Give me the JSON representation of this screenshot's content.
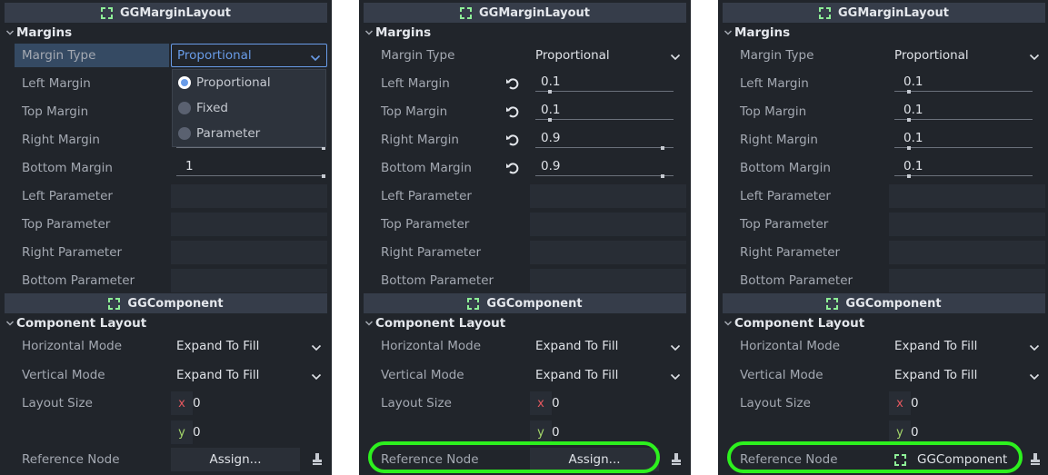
{
  "panels": [
    {
      "margin_header": "GGMarginLayout",
      "margins_section": "Margins",
      "margin_type_label": "Margin Type",
      "margin_type_value": "Proportional",
      "margin_type_open": true,
      "dropdown_options": [
        "Proportional",
        "Fixed",
        "Parameter"
      ],
      "dropdown_selected": 0,
      "left_margin_label": "Left Margin",
      "top_margin_label": "Top Margin",
      "right_margin_label": "Right Margin",
      "bottom_margin_label": "Bottom Margin",
      "bottom_margin_value": "1",
      "left_param_label": "Left Parameter",
      "top_param_label": "Top Parameter",
      "right_param_label": "Right Parameter",
      "bottom_param_label": "Bottom Parameter",
      "component_header": "GGComponent",
      "layout_section": "Component Layout",
      "hmode_label": "Horizontal Mode",
      "hmode_value": "Expand To Fill",
      "vmode_label": "Vertical Mode",
      "vmode_value": "Expand To Fill",
      "size_label": "Layout Size",
      "size_x_axis": "x",
      "size_x": "0",
      "size_y_axis": "y",
      "size_y": "0",
      "ref_label": "Reference Node",
      "ref_value": "Assign..."
    },
    {
      "margin_header": "GGMarginLayout",
      "margins_section": "Margins",
      "margin_type_label": "Margin Type",
      "margin_type_value": "Proportional",
      "left_margin_label": "Left Margin",
      "left_margin_value": "0.1",
      "top_margin_label": "Top Margin",
      "top_margin_value": "0.1",
      "right_margin_label": "Right Margin",
      "right_margin_value": "0.9",
      "bottom_margin_label": "Bottom Margin",
      "bottom_margin_value": "0.9",
      "left_param_label": "Left Parameter",
      "top_param_label": "Top Parameter",
      "right_param_label": "Right Parameter",
      "bottom_param_label": "Bottom Parameter",
      "component_header": "GGComponent",
      "layout_section": "Component Layout",
      "hmode_label": "Horizontal Mode",
      "hmode_value": "Expand To Fill",
      "vmode_label": "Vertical Mode",
      "vmode_value": "Expand To Fill",
      "size_label": "Layout Size",
      "size_x_axis": "x",
      "size_x": "0",
      "size_y_axis": "y",
      "size_y": "0",
      "ref_label": "Reference Node",
      "ref_value": "Assign..."
    },
    {
      "margin_header": "GGMarginLayout",
      "margins_section": "Margins",
      "margin_type_label": "Margin Type",
      "margin_type_value": "Proportional",
      "left_margin_label": "Left Margin",
      "left_margin_value": "0.1",
      "top_margin_label": "Top Margin",
      "top_margin_value": "0.1",
      "right_margin_label": "Right Margin",
      "right_margin_value": "0.1",
      "bottom_margin_label": "Bottom Margin",
      "bottom_margin_value": "0.1",
      "left_param_label": "Left Parameter",
      "top_param_label": "Top Parameter",
      "right_param_label": "Right Parameter",
      "bottom_param_label": "Bottom Parameter",
      "component_header": "GGComponent",
      "layout_section": "Component Layout",
      "hmode_label": "Horizontal Mode",
      "hmode_value": "Expand To Fill",
      "vmode_label": "Vertical Mode",
      "vmode_value": "Expand To Fill",
      "size_label": "Layout Size",
      "size_x_axis": "x",
      "size_x": "0",
      "size_y_axis": "y",
      "size_y": "0",
      "ref_label": "Reference Node",
      "ref_value": "GGComponent"
    }
  ],
  "colors": {
    "panel_bg": "#21252b",
    "header_bg": "#363d4a",
    "accent": "#699ce8",
    "node_icon": "#8eef97",
    "highlight_ring": "#2df01e",
    "axis_x": "#e5585f",
    "axis_y": "#a5d86a"
  },
  "icons": [
    "node-icon",
    "collapse-chevron-icon",
    "dropdown-arrow-icon",
    "revert-icon",
    "clear-icon",
    "radio-icon"
  ]
}
